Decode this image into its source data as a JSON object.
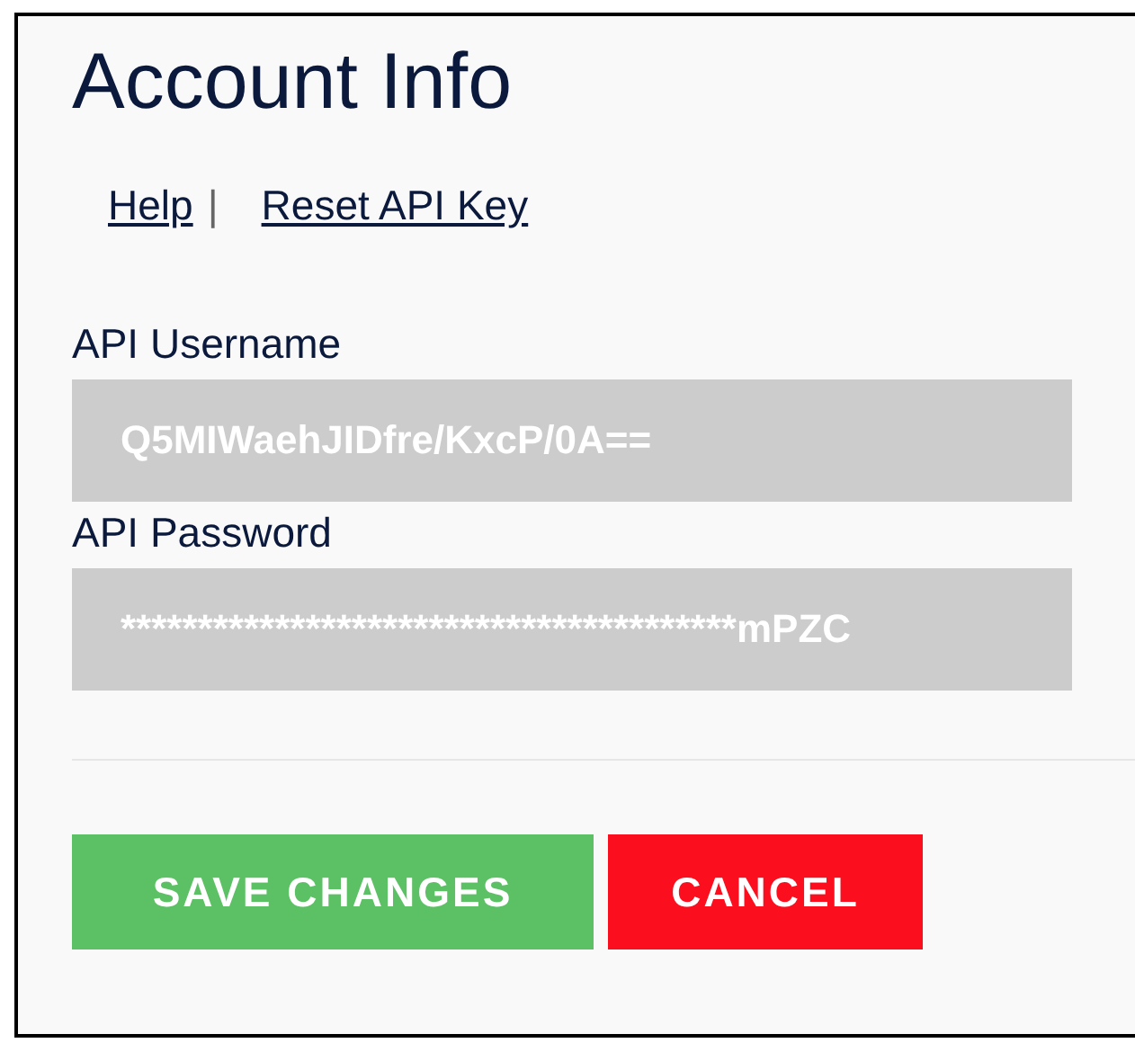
{
  "title": "Account Info",
  "links": [
    {
      "label": "Help",
      "separator": "|"
    },
    {
      "label": "Reset API Key"
    }
  ],
  "fields": [
    {
      "label": "API Username",
      "value": "Q5MIWaehJIDfre/KxcP/0A=="
    },
    {
      "label": "API Password",
      "value": "****************************************mPZC"
    }
  ],
  "buttons": [
    {
      "label": "SAVE CHANGES",
      "kind": "primary"
    },
    {
      "label": "CANCEL",
      "kind": "danger"
    }
  ]
}
